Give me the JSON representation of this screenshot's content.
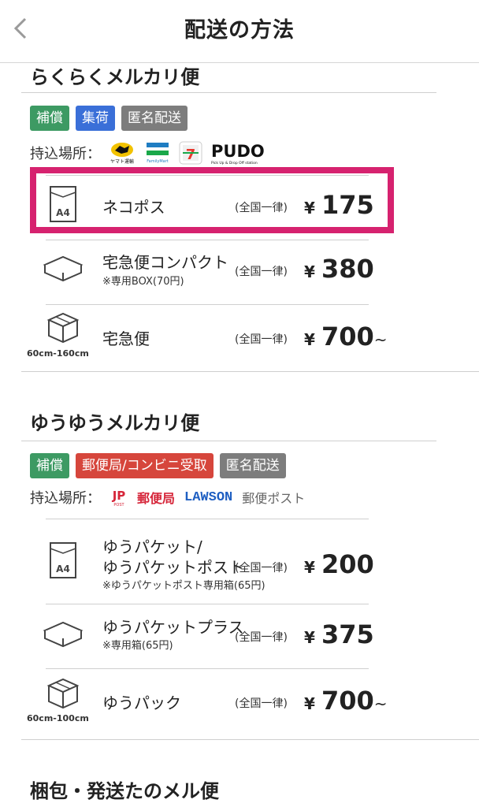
{
  "header": {
    "title": "配送の方法",
    "back_icon": "chevron-left-icon"
  },
  "rakuraku": {
    "title": "らくらくメルカリ便",
    "tags": [
      "補償",
      "集荷",
      "匿名配送"
    ],
    "dropoff_label": "持込場所：",
    "logos": {
      "yamato": "ヤマト運輸",
      "familymart": "FamilyMart",
      "pudo": "PUDO",
      "pudo_sub": "Pick Up & Drop Off station"
    },
    "items": [
      {
        "name": "ネコポス",
        "sub": "",
        "uniform": "(全国一律)",
        "yen": "¥",
        "price": "175",
        "suffix": "",
        "icon_label": "A4",
        "size": ""
      },
      {
        "name": "宅急便コンパクト",
        "sub": "※専用BOX(70円)",
        "uniform": "(全国一律)",
        "yen": "¥",
        "price": "380",
        "suffix": "",
        "icon_label": "",
        "size": ""
      },
      {
        "name": "宅急便",
        "sub": "",
        "uniform": "(全国一律)",
        "yen": "¥",
        "price": "700",
        "suffix": "~",
        "icon_label": "",
        "size": "60cm-160cm"
      }
    ]
  },
  "yuyu": {
    "title": "ゆうゆうメルカリ便",
    "tags": [
      "補償",
      "郵便局/コンビニ受取",
      "匿名配送"
    ],
    "dropoff_label": "持込場所：",
    "logos": {
      "jp": "JP",
      "jp_post": "POST",
      "yubinkyoku": "郵便局",
      "lawson": "LAWSON",
      "yubin_post": "郵便ポスト"
    },
    "items": [
      {
        "name_line1": "ゆうパケット/",
        "name_line2": "ゆうパケットポスト",
        "sub": "※ゆうパケットポスト専用箱(65円)",
        "uniform": "(全国一律)",
        "yen": "¥",
        "price": "200",
        "suffix": "",
        "icon_label": "A4"
      },
      {
        "name": "ゆうパケットプラス",
        "sub": "※専用箱(65円)",
        "uniform": "(全国一律)",
        "yen": "¥",
        "price": "375",
        "suffix": ""
      },
      {
        "name": "ゆうパック",
        "sub": "",
        "uniform": "(全国一律)",
        "yen": "¥",
        "price": "700",
        "suffix": "~",
        "size": "60cm-100cm"
      }
    ]
  },
  "next_section": {
    "title": "梱包・発送たのメル便"
  },
  "colors": {
    "accent_highlight": "#d6226f",
    "tag_green": "#3d9a63",
    "tag_blue": "#3a6fd8",
    "tag_gray": "#7d7d7d",
    "tag_red": "#d6463c"
  }
}
